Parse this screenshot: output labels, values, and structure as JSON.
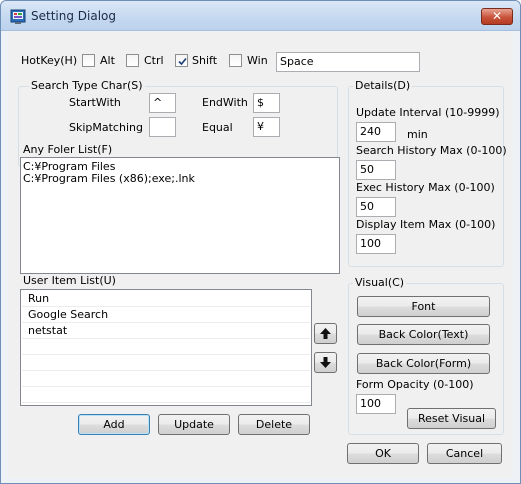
{
  "window": {
    "title": "Setting Dialog",
    "close_glyph": "✕"
  },
  "hotkey": {
    "label": "HotKey(H)",
    "alt": {
      "label": "Alt",
      "checked": false
    },
    "ctrl": {
      "label": "Ctrl",
      "checked": false
    },
    "shift": {
      "label": "Shift",
      "checked": true
    },
    "win": {
      "label": "Win",
      "checked": false
    },
    "key_value": "Space"
  },
  "search_type": {
    "title": "Search Type Char(S)",
    "start_with": {
      "label": "StartWith",
      "value": "^"
    },
    "end_with": {
      "label": "EndWith",
      "value": "$"
    },
    "skip_matching": {
      "label": "SkipMatching",
      "value": ""
    },
    "equal": {
      "label": "Equal",
      "value": "¥"
    }
  },
  "any_folder": {
    "label": "Any Foler List(F)",
    "lines": [
      "C:¥Program Files",
      "C:¥Program Files (x86);exe;.lnk"
    ]
  },
  "user_items": {
    "label": "User Item List(U)",
    "items": [
      "Run",
      "Google Search",
      "netstat"
    ],
    "empty_rows": 5
  },
  "list_buttons": {
    "add": "Add",
    "update": "Update",
    "delete": "Delete"
  },
  "details": {
    "title": "Details(D)",
    "update_interval": {
      "label": "Update Interval (10-9999)",
      "value": "240",
      "unit": "min"
    },
    "search_history": {
      "label": "Search History Max (0-100)",
      "value": "50"
    },
    "exec_history": {
      "label": "Exec History Max (0-100)",
      "value": "50"
    },
    "display_item": {
      "label": "Display Item Max (0-100)",
      "value": "100"
    }
  },
  "visual": {
    "title": "Visual(C)",
    "font_button": "Font",
    "back_color_text": "Back Color(Text)",
    "back_color_form": "Back Color(Form)",
    "opacity": {
      "label": "Form Opacity (0-100)",
      "value": "100"
    },
    "reset_button": "Reset Visual"
  },
  "footer": {
    "ok": "OK",
    "cancel": "Cancel"
  },
  "icons": {
    "app": "settings-app-icon",
    "up": "arrow-up-icon",
    "down": "arrow-down-icon"
  }
}
